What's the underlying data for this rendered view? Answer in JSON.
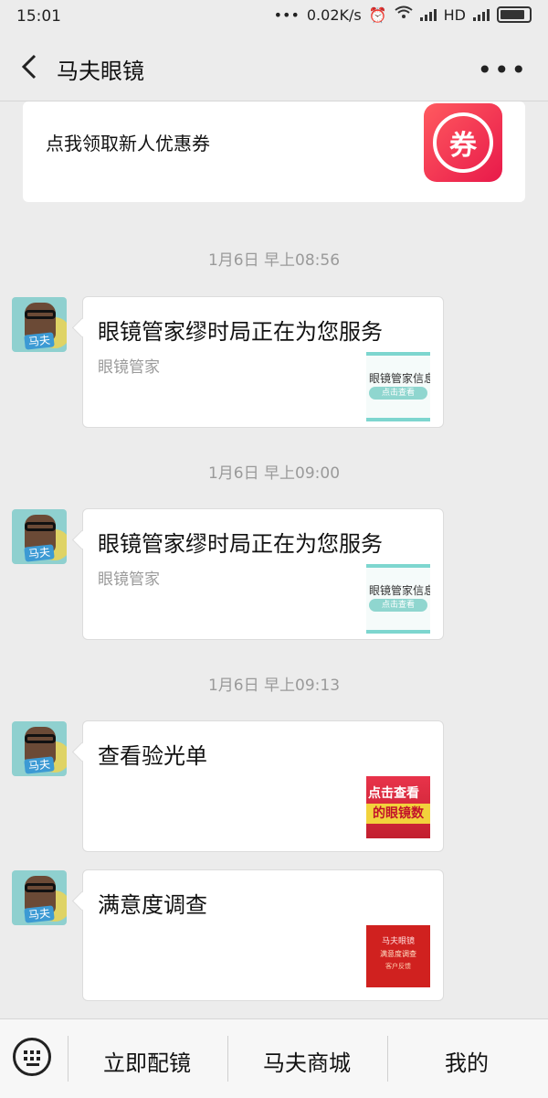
{
  "statusbar": {
    "time": "15:01",
    "dots": "•••",
    "speed": "0.02K/s",
    "hd": "HD",
    "icons": [
      "alarm-icon",
      "wifi-icon",
      "signal-icon",
      "battery-icon"
    ]
  },
  "header": {
    "title": "马夫眼镜",
    "back_icon": "chevron-left-icon",
    "more": "•••"
  },
  "coupon": {
    "text": "点我领取新人优惠券",
    "icon_char": "券",
    "accent": "#e8194a"
  },
  "messages": [
    {
      "time": "1月6日 早上08:56",
      "title": "眼镜管家缪时局正在为您服务",
      "subtitle": "眼镜管家",
      "thumb_line1": "眼镜管家信息",
      "thumb_line2": "点击查看"
    },
    {
      "time": "1月6日 早上09:00",
      "title": "眼镜管家缪时局正在为您服务",
      "subtitle": "眼镜管家",
      "thumb_line1": "眼镜管家信息",
      "thumb_line2": "点击查看"
    },
    {
      "time": "1月6日 早上09:13",
      "title": "查看验光单",
      "thumb_line1": "点击查看",
      "thumb_line2": "的眼镜数"
    },
    {
      "title": "满意度调查",
      "thumb_line1": "马夫眼镜",
      "thumb_line2": "满意度调查",
      "thumb_line3": "客户反馈"
    }
  ],
  "avatar_label": "马夫",
  "bottom_menu": {
    "keyboard_icon": "keyboard-icon",
    "items": [
      "立即配镜",
      "马夫商城",
      "我的"
    ]
  }
}
